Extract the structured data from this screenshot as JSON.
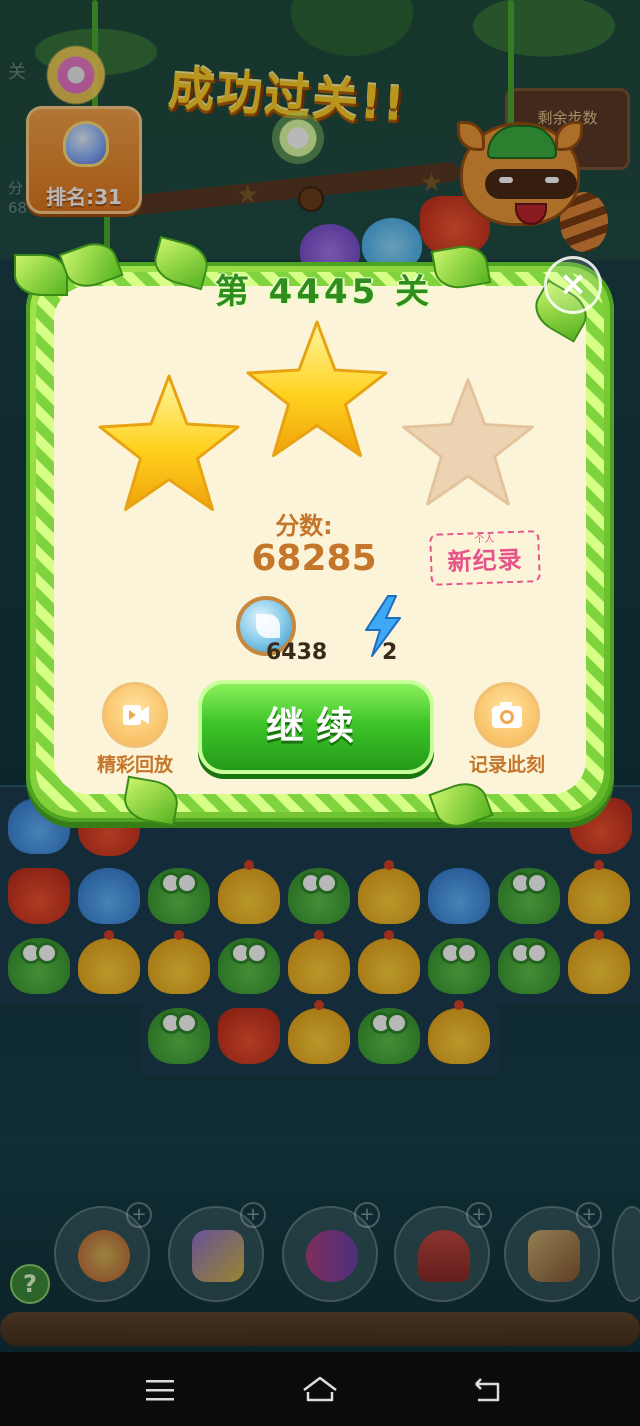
{
  "background": {
    "level_header": "关",
    "moves_label": "剩余步数",
    "side_label": "分\n68"
  },
  "rank_badge": {
    "label": "排名:31"
  },
  "success_title": "成功过关!!",
  "panel": {
    "level_title": "第 4445 关",
    "close_symbol": "×",
    "stars_earned": 2,
    "stars_total": 3,
    "score_label": "分数:",
    "score_value": "68285",
    "record_stamp": {
      "small": "个人",
      "big": "新纪录"
    },
    "coins": "6438",
    "energy": "2",
    "replay_label": "精彩回放",
    "continue_label": "继续",
    "snapshot_label": "记录此刻"
  },
  "help_symbol": "?",
  "colors": {
    "panel_green": "#5fb829",
    "parchment": "#fbf4d8",
    "score_brown": "#c4762b",
    "continue_green": "#3fc62a",
    "stamp_pink": "#e5548a",
    "star_gold": "#ffd02a"
  },
  "icons": [
    "replay-video-icon",
    "camera-icon",
    "leaf-coin-icon",
    "lightning-icon",
    "close-icon",
    "menu-icon",
    "home-icon",
    "back-icon"
  ]
}
